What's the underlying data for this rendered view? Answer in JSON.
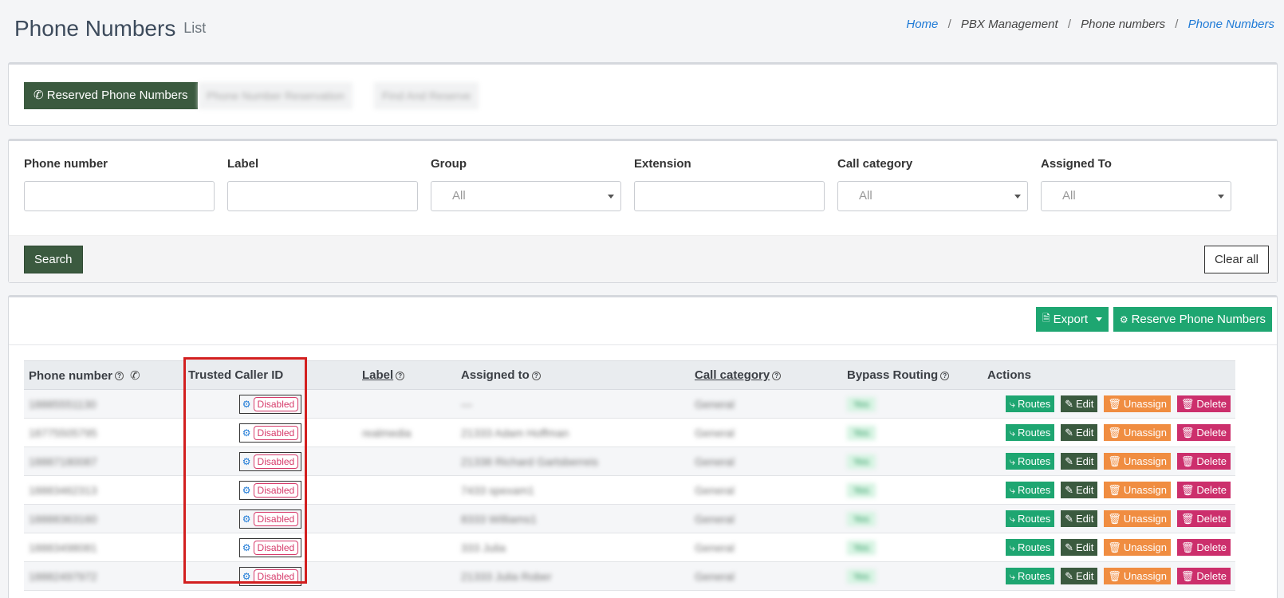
{
  "header": {
    "title": "Phone Numbers",
    "subtitle": "List",
    "breadcrumb": [
      "Home",
      "PBX Management",
      "Phone numbers",
      "Phone Numbers"
    ]
  },
  "tabs": {
    "active_label": "Reserved Phone Numbers",
    "blurred_1": "Phone Number Reservation",
    "blurred_2": "Find And Reserve"
  },
  "filters": {
    "phone_number_label": "Phone number",
    "label_label": "Label",
    "group_label": "Group",
    "group_value": "All",
    "extension_label": "Extension",
    "call_category_label": "Call category",
    "call_category_value": "All",
    "assigned_to_label": "Assigned To",
    "assigned_to_value": "All",
    "search_label": "Search",
    "clear_label": "Clear all"
  },
  "toolbar": {
    "export_label": "Export",
    "reserve_label": "Reserve Phone Numbers"
  },
  "table": {
    "columns": {
      "phone_number": "Phone number",
      "trusted": "Trusted Caller ID",
      "label": "Label",
      "assigned_to": "Assigned to",
      "call_category": "Call category",
      "bypass": "Bypass Routing",
      "actions": "Actions"
    },
    "rows": [
      {
        "phone": "18885551130",
        "trusted": "Disabled",
        "label": "",
        "assigned": "—",
        "category": "General",
        "bypass": "Yes"
      },
      {
        "phone": "18775505795",
        "trusted": "Disabled",
        "label": "realmedia",
        "assigned": "21333 Adam Hoffman",
        "category": "General",
        "bypass": "Yes"
      },
      {
        "phone": "18887180087",
        "trusted": "Disabled",
        "label": "",
        "assigned": "21338 Richard Gartsberreis",
        "category": "General",
        "bypass": "Yes"
      },
      {
        "phone": "18883462313",
        "trusted": "Disabled",
        "label": "",
        "assigned": "7433 spexam1",
        "category": "General",
        "bypass": "Yes"
      },
      {
        "phone": "18888363160",
        "trusted": "Disabled",
        "label": "",
        "assigned": "8333 Williams1",
        "category": "General",
        "bypass": "Yes"
      },
      {
        "phone": "18883498081",
        "trusted": "Disabled",
        "label": "",
        "assigned": "333 Julia",
        "category": "General",
        "bypass": "Yes"
      },
      {
        "phone": "18882497972",
        "trusted": "Disabled",
        "label": "",
        "assigned": "21333 Julia Rober",
        "category": "General",
        "bypass": "Yes"
      }
    ],
    "actions": {
      "routes": "Routes",
      "edit": "Edit",
      "unassign": "Unassign",
      "delete": "Delete"
    }
  },
  "colors": {
    "primary_dark": "#3b5a3f",
    "success": "#1ea671",
    "warning": "#f08d41",
    "danger": "#cc2f6c",
    "link": "#1e7ad6",
    "highlight": "#d21f1f"
  }
}
